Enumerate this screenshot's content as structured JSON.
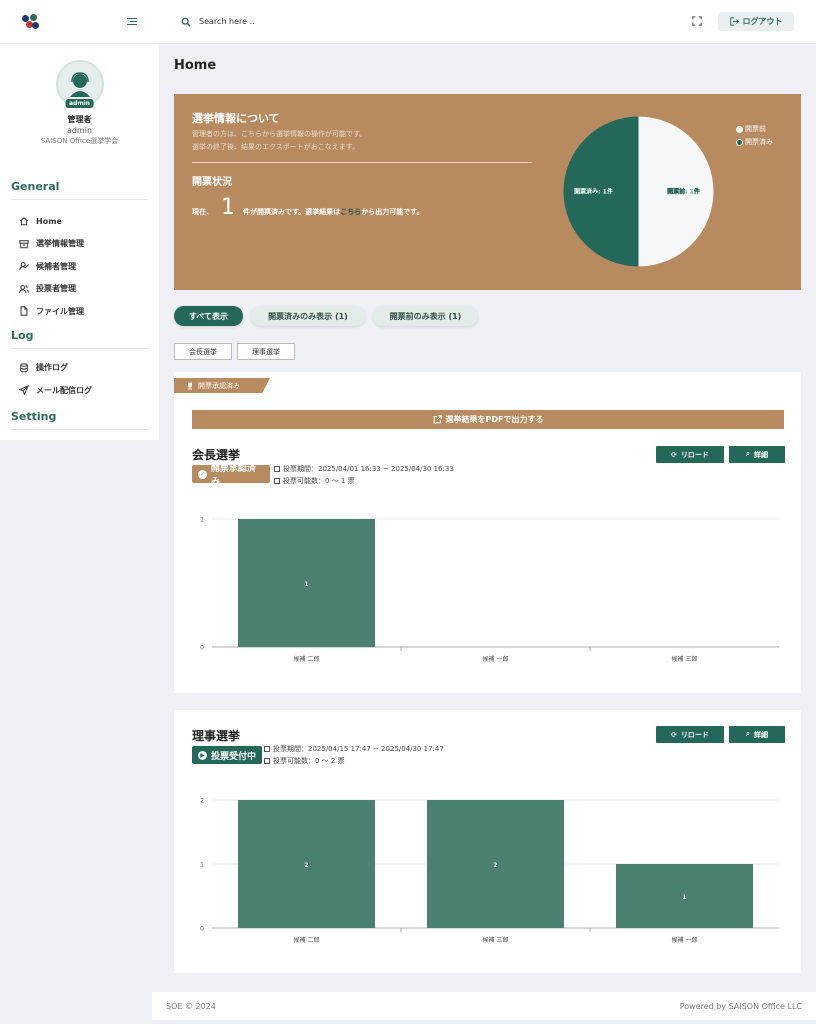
{
  "sidebar": {
    "profile": {
      "role": "管理者",
      "id": "admin",
      "org": "SAISON Office選挙学会",
      "badge": "admin"
    },
    "sections": [
      {
        "title": "General",
        "items": [
          {
            "label": "Home",
            "icon": "home-icon"
          },
          {
            "label": "選挙情報管理",
            "icon": "archive-icon"
          },
          {
            "label": "候補者管理",
            "icon": "user-check-icon"
          },
          {
            "label": "投票者管理",
            "icon": "users-icon"
          },
          {
            "label": "ファイル管理",
            "icon": "file-icon"
          }
        ]
      },
      {
        "title": "Log",
        "items": [
          {
            "label": "操作ログ",
            "icon": "database-icon"
          },
          {
            "label": "メール配信ログ",
            "icon": "send-icon"
          }
        ]
      },
      {
        "title": "Setting",
        "items": []
      }
    ]
  },
  "topbar": {
    "search_placeholder": "Search here ..",
    "logout_label": "ログアウト"
  },
  "page": {
    "title": "Home"
  },
  "hero": {
    "title": "選挙情報について",
    "desc_line1": "管理者の方は、こちらから選挙情報の操作が可能です。",
    "desc_line2": "選挙の終了後、結果のエクスポートがおこなえます。",
    "status_title": "開票状況",
    "status_prefix": "現在、",
    "status_count": "1",
    "status_mid": "件が開票済みです。選挙結果は",
    "status_link": "こちら",
    "status_suffix": "から出力可能です。",
    "pie": {
      "slices": [
        {
          "name": "開票前",
          "value": 1,
          "label": "開票前: 1件",
          "color": "#f5f7f8"
        },
        {
          "name": "開票済み",
          "value": 1,
          "label": "開票済み: 1件",
          "color": "#24685a"
        }
      ]
    }
  },
  "filters": {
    "all": "すべて表示",
    "opened": "開票済みのみ表示 (1)",
    "unopened": "開票前のみ表示 (1)"
  },
  "tabs": [
    "会長選挙",
    "理事選挙"
  ],
  "card1": {
    "ribbon": "開票承認済み",
    "export_label": "選挙結果をPDFで出力する",
    "title": "会長選挙",
    "status": "開票承認済み",
    "period": "投票期間：2025/04/01 16:33 ~ 2025/04/30 16:33",
    "votes": "投票可能数：0 〜 1 票",
    "reload": "リロード",
    "detail": "詳細"
  },
  "card2": {
    "title": "理事選挙",
    "status": "投票受付中",
    "period": "投票期間：2025/04/15 17:47 ~ 2025/04/30 17:47",
    "votes": "投票可能数：0 〜 2 票",
    "reload": "リロード",
    "detail": "詳細"
  },
  "footer": {
    "left": "SOE © 2024",
    "right": "Powered by SAISON Office LLC"
  },
  "colors": {
    "accent": "#24685a",
    "brown": "#b88a5f",
    "bar": "#4a7f72"
  },
  "chart_data": [
    {
      "type": "pie",
      "categories": [
        "開票前",
        "開票済み"
      ],
      "values": [
        1,
        1
      ],
      "legend": "top-right"
    },
    {
      "type": "bar",
      "title": "会長選挙",
      "categories": [
        "候補 二郎",
        "候補 一郎",
        "候補 三郎"
      ],
      "values": [
        1,
        0,
        0
      ],
      "ylim": [
        0,
        1
      ],
      "yticks": [
        0,
        1
      ],
      "grid": true
    },
    {
      "type": "bar",
      "title": "理事選挙",
      "categories": [
        "候補 二郎",
        "候補 三郎",
        "候補 一郎"
      ],
      "values": [
        2,
        2,
        1
      ],
      "ylim": [
        0,
        2
      ],
      "yticks": [
        0,
        1,
        2
      ],
      "grid": true
    }
  ]
}
